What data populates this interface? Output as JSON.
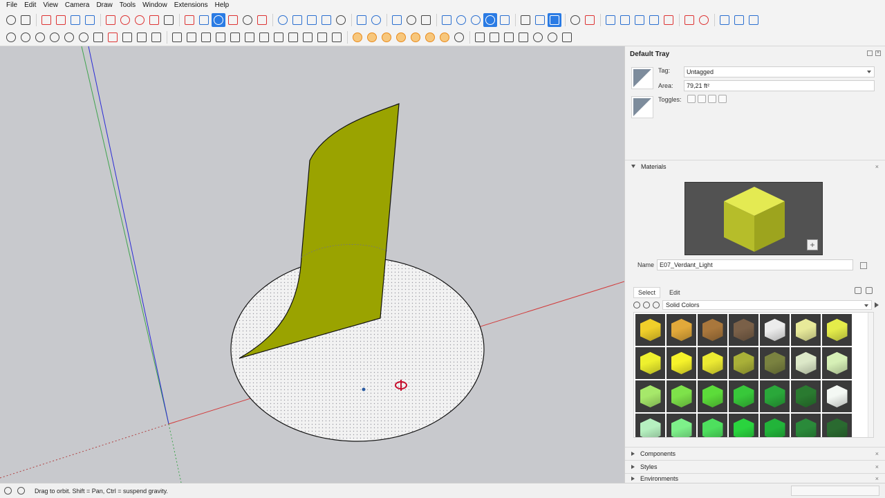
{
  "menu": [
    "File",
    "Edit",
    "View",
    "Camera",
    "Draw",
    "Tools",
    "Window",
    "Extensions",
    "Help"
  ],
  "tray": {
    "title": "Default Tray",
    "entity_info": {
      "tag_label": "Tag:",
      "tag_value": "Untagged",
      "area_label": "Area:",
      "area_value": "79,21 ft²",
      "toggles_label": "Toggles:"
    },
    "materials": {
      "header": "Materials",
      "name_label": "Name",
      "name_value": "E07_Verdant_Light",
      "tab_select": "Select",
      "tab_edit": "Edit",
      "library": "Solid Colors",
      "preview_color": "#c9d13a",
      "swatch_colors": [
        "#f0cf2a",
        "#e2a93a",
        "#a9773c",
        "#7a6048",
        "#ececec",
        "#e8ea9a",
        "#e4ec4a",
        "#eef02e",
        "#f6f22a",
        "#ecea32",
        "#a9b038",
        "#7a8240",
        "#dce8c8",
        "#d6f0b6",
        "#a6e86a",
        "#7ee24a",
        "#5cdc3a",
        "#38c83a",
        "#2aa83a",
        "#2a7a30",
        "#f4f8f4",
        "#b6f0c0",
        "#7ef08a",
        "#4ee05e",
        "#2ad43e",
        "#22b43a",
        "#2a8a3a",
        "#2a6a30"
      ]
    },
    "collapsed_panels": [
      "Components",
      "Styles",
      "Environments"
    ]
  },
  "status": {
    "hint": "Drag to orbit. Shift = Pan, Ctrl = suspend gravity."
  },
  "colors": {
    "viewport_bg": "#c8c9cd",
    "face_color": "#9aa300",
    "active_tool": "#2a7be4"
  }
}
